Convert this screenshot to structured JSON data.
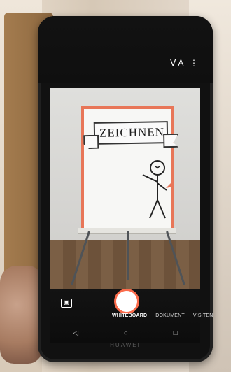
{
  "banner": {
    "title": "ZEICHNEN"
  },
  "camera": {
    "top_icons": "ᐯA ⋮",
    "modes": [
      "WHITEBOARD",
      "DOKUMENT",
      "VISITEN"
    ],
    "gallery_icon": "▣",
    "shutter_label": ""
  },
  "nav": {
    "back": "◁",
    "home": "○",
    "recents": "□"
  },
  "brand": {
    "name": "HUAWEI"
  }
}
